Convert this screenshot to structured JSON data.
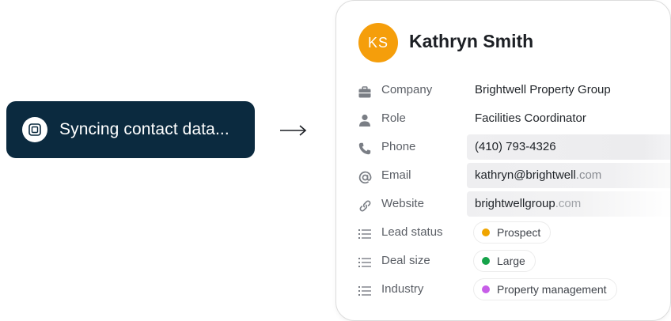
{
  "sync": {
    "icon": "sync-chip-icon",
    "text": "Syncing contact data..."
  },
  "arrow": {
    "icon": "arrow-right-icon"
  },
  "contact": {
    "initials": "KS",
    "avatar_color": "#f59e0b",
    "name": "Kathryn Smith",
    "fields": {
      "company": {
        "icon": "briefcase-icon",
        "label": "Company",
        "value": "Brightwell Property Group"
      },
      "role": {
        "icon": "person-icon",
        "label": "Role",
        "value": "Facilities Coordinator"
      },
      "phone": {
        "icon": "phone-icon",
        "label": "Phone",
        "value": "(410) 793-4326"
      },
      "email": {
        "icon": "at-sign-icon",
        "label": "Email",
        "value_main": "kathryn@brightwell",
        "value_tail": ".com"
      },
      "website": {
        "icon": "link-icon",
        "label": "Website",
        "value_main": "brightwellgroup",
        "value_tail": ".com"
      },
      "lead_status": {
        "icon": "list-icon",
        "label": "Lead status",
        "tag": "Prospect",
        "tag_color": "#f0a500"
      },
      "deal_size": {
        "icon": "list-icon",
        "label": "Deal size",
        "tag": "Large",
        "tag_color": "#16a34a"
      },
      "industry": {
        "icon": "list-icon",
        "label": "Industry",
        "tag": "Property management",
        "tag_color": "#c75ee8"
      }
    }
  }
}
